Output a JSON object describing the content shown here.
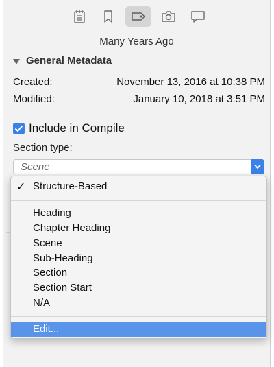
{
  "toolbar": {
    "buttons": [
      {
        "icon": "notes-icon",
        "active": false
      },
      {
        "icon": "bookmark-icon",
        "active": false
      },
      {
        "icon": "metadata-tag-icon",
        "active": true
      },
      {
        "icon": "snapshot-camera-icon",
        "active": false
      },
      {
        "icon": "comments-icon",
        "active": false
      }
    ]
  },
  "document_title": "Many Years Ago",
  "general_metadata": {
    "heading": "General Metadata",
    "created_label": "Created:",
    "created_value": "November 13, 2016 at 10:38 PM",
    "modified_label": "Modified:",
    "modified_value": "January 10, 2018 at 3:51 PM"
  },
  "include_in_compile": {
    "label": "Include in Compile",
    "checked": true
  },
  "section_type": {
    "label": "Section type:",
    "selected": "Scene"
  },
  "dropdown": {
    "checked_item": "Structure-Based",
    "items": [
      "Heading",
      "Chapter Heading",
      "Scene",
      "Sub-Heading",
      "Section",
      "Section Start",
      "N/A"
    ],
    "edit_item": "Edit..."
  },
  "colors": {
    "accent": "#3b82e8",
    "highlight": "#5a93ea"
  }
}
